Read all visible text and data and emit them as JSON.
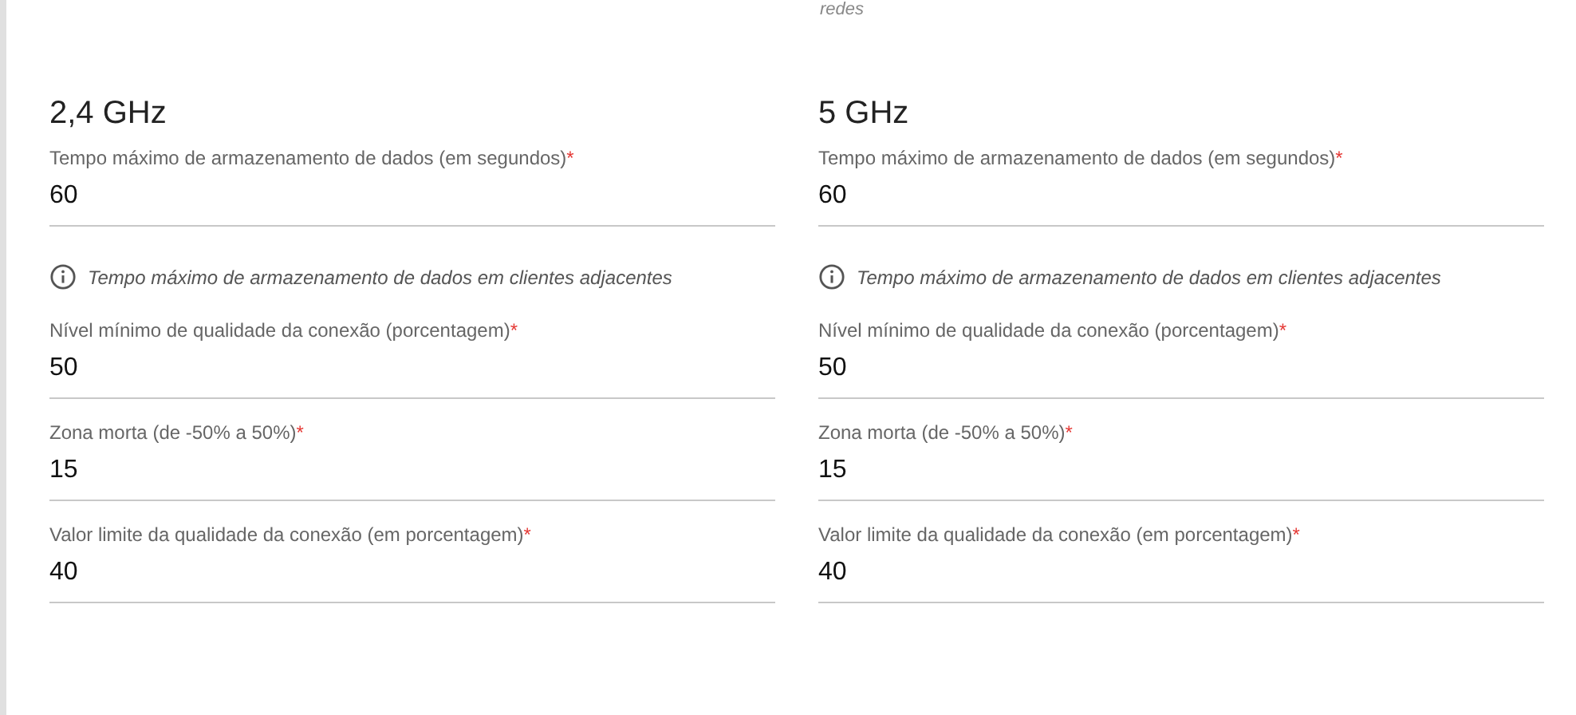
{
  "top_note": "redes",
  "bands": [
    {
      "title": "2,4 GHz",
      "items": [
        {
          "kind": "field",
          "label": "Tempo máximo de armazenamento de dados (em segundos)",
          "required_mark": "*",
          "value": "60"
        },
        {
          "kind": "hint",
          "text": "Tempo máximo de armazenamento de dados em clientes adjacentes"
        },
        {
          "kind": "field",
          "label": "Nível mínimo de qualidade da conexão (porcentagem)",
          "required_mark": "*",
          "value": "50"
        },
        {
          "kind": "field",
          "label": "Zona morta (de -50% a 50%)",
          "required_mark": "*",
          "value": "15"
        },
        {
          "kind": "field",
          "label": "Valor limite da qualidade da conexão (em porcentagem)",
          "required_mark": "*",
          "value": "40"
        }
      ]
    },
    {
      "title": "5 GHz",
      "items": [
        {
          "kind": "field",
          "label": "Tempo máximo de armazenamento de dados (em segundos)",
          "required_mark": "*",
          "value": "60"
        },
        {
          "kind": "hint",
          "text": "Tempo máximo de armazenamento de dados em clientes adjacentes"
        },
        {
          "kind": "field",
          "label": "Nível mínimo de qualidade da conexão (porcentagem)",
          "required_mark": "*",
          "value": "50"
        },
        {
          "kind": "field",
          "label": "Zona morta (de -50% a 50%)",
          "required_mark": "*",
          "value": "15"
        },
        {
          "kind": "field",
          "label": "Valor limite da qualidade da conexão (em porcentagem)",
          "required_mark": "*",
          "value": "40"
        }
      ]
    }
  ]
}
